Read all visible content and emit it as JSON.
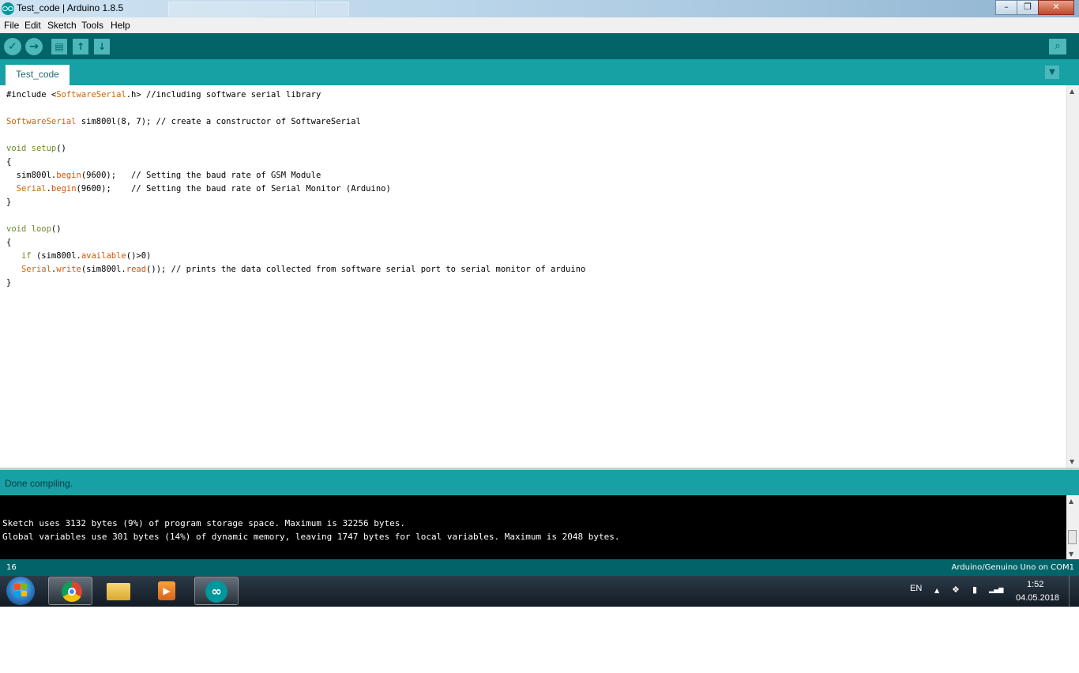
{
  "window": {
    "title": "Test_code | Arduino 1.8.5",
    "minimize": "–",
    "restore": "❐",
    "close": "✕"
  },
  "menu": {
    "items": [
      "File",
      "Edit",
      "Sketch",
      "Tools",
      "Help"
    ]
  },
  "toolbar": {
    "verify_icon": "✓",
    "upload_icon": "→",
    "new_icon": "▤",
    "open_icon": "↑",
    "save_icon": "↓",
    "serial_icon": "⌕"
  },
  "tabs": {
    "active": "Test_code",
    "menu_icon": "▼"
  },
  "code": {
    "lines": [
      [
        "#include <",
        "SoftwareSerial",
        ".h> //including software serial library"
      ],
      [
        "SoftwareSerial",
        " sim800l(8, 7); // create a constructor of SoftwareSerial"
      ],
      [
        "void",
        " ",
        "setup",
        "()"
      ],
      [
        "{"
      ],
      [
        "  sim800l.",
        "begin",
        "(9600);   // Setting the baud rate of GSM Module"
      ],
      [
        "  ",
        "Serial",
        ".",
        "begin",
        "(9600);    // Setting the baud rate of Serial Monitor (Arduino)"
      ],
      [
        "}"
      ],
      [
        "void",
        " ",
        "loop",
        "()"
      ],
      [
        "{"
      ],
      [
        "   ",
        "if",
        " (sim800l.",
        "available",
        "()>0)"
      ],
      [
        "   ",
        "Serial",
        ".",
        "write",
        "(sim800l.",
        "read",
        "()); // prints the data collected from software serial port to serial monitor of arduino"
      ],
      [
        "}"
      ]
    ]
  },
  "status": {
    "message": "Done compiling."
  },
  "console": {
    "lines": [
      "Sketch uses 3132 bytes (9%) of program storage space. Maximum is 32256 bytes.",
      "Global variables use 301 bytes (14%) of dynamic memory, leaving 1747 bytes for local variables. Maximum is 2048 bytes."
    ]
  },
  "footer": {
    "line_number": "16",
    "board": "Arduino/Genuino Uno on COM1"
  },
  "taskbar": {
    "language": "EN",
    "time": "1:52",
    "date": "04.05.2018",
    "tray_up_icon": "▲",
    "dropbox_icon": "❖",
    "battery_icon": "▮",
    "signal_icon": "▂▄▆"
  }
}
